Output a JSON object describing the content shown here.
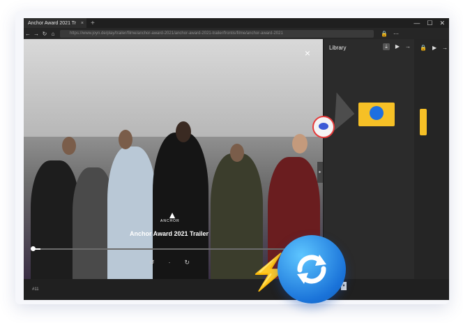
{
  "browser": {
    "tab_title": "Anchor Award 2021 Tr",
    "tab_close": "×",
    "new_tab": "+",
    "url": "https://www.joyn.de/play/trailer/filme/anchor-award-2021/anchor-award-2021-trailer/frontis/filme/anchor-award-2021",
    "win_controls": [
      "—",
      "☐",
      "✕"
    ]
  },
  "video": {
    "close": "×",
    "logo_text": "ANCHOR",
    "title": "Anchor Award 2021 Trailer",
    "progress_fraction": 0.03,
    "controls": [
      "↺",
      "·",
      "↻"
    ]
  },
  "library": {
    "title": "Library",
    "icons": [
      "⤓",
      "▶",
      "→"
    ]
  },
  "right_panel": {
    "icons": [
      "🔒",
      "▶",
      "→"
    ]
  },
  "bottom": {
    "text": "#11",
    "dropdown": "▾"
  },
  "colors": {
    "accent_yellow": "#f6c026",
    "sync_blue": "#1a73d9"
  }
}
